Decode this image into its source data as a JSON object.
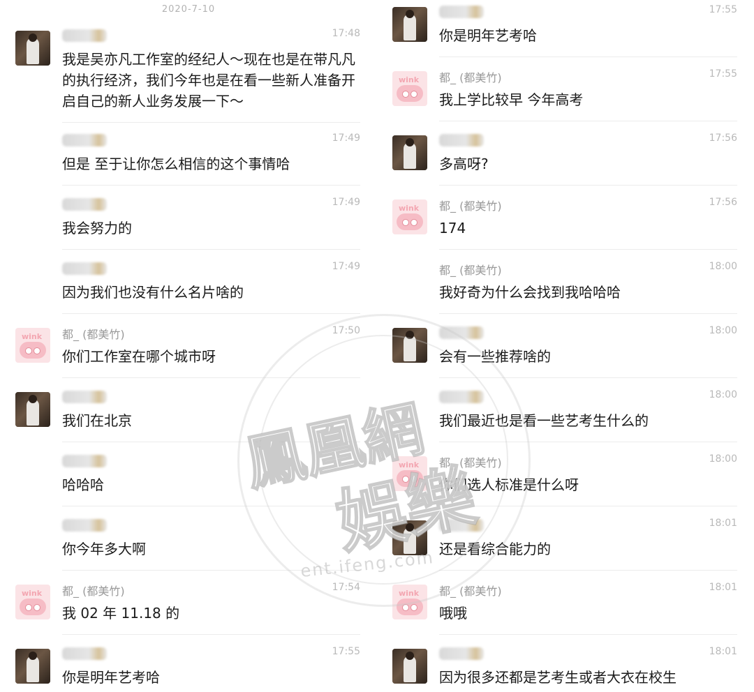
{
  "date_divider": "2020-7-10",
  "contacts": {
    "agent_name": "",
    "user_name": "都_ (都美竹)"
  },
  "left_messages": [
    {
      "sender": "agent",
      "time": "17:48",
      "text": "我是吴亦凡工作室的经纪人～现在也是在带凡凡的执行经济，我们今年也是在看一些新人准备开启自己的新人业务发展一下～"
    },
    {
      "sender": "agent",
      "time": "17:49",
      "text": "但是 至于让你怎么相信的这个事情哈"
    },
    {
      "sender": "agent",
      "time": "17:49",
      "text": "我会努力的"
    },
    {
      "sender": "agent",
      "time": "17:49",
      "text": "因为我们也没有什么名片啥的"
    },
    {
      "sender": "user",
      "time": "17:50",
      "text": "你们工作室在哪个城市呀"
    },
    {
      "sender": "agent",
      "time": "",
      "text": "我们在北京"
    },
    {
      "sender": "agent",
      "time": "",
      "text": "哈哈哈"
    },
    {
      "sender": "agent",
      "time": "",
      "text": "你今年多大啊"
    },
    {
      "sender": "user",
      "time": "17:54",
      "text": "我 02 年 11.18 的"
    },
    {
      "sender": "agent",
      "time": "17:55",
      "text": "你是明年艺考哈"
    }
  ],
  "right_messages": [
    {
      "sender": "agent",
      "time": "17:55",
      "text": "你是明年艺考哈"
    },
    {
      "sender": "user",
      "time": "17:55",
      "text": "我上学比较早 今年高考"
    },
    {
      "sender": "agent",
      "time": "17:56",
      "text": "多高呀?"
    },
    {
      "sender": "user",
      "time": "17:56",
      "text": "174"
    },
    {
      "sender": "user",
      "time": "18:00",
      "text": "我好奇为什么会找到我哈哈哈"
    },
    {
      "sender": "agent",
      "time": "18:00",
      "text": "会有一些推荐啥的"
    },
    {
      "sender": "agent",
      "time": "18:00",
      "text": "我们最近也是看一些艺考生什么的"
    },
    {
      "sender": "user",
      "time": "18:00",
      "text": "你们选人标准是什么呀"
    },
    {
      "sender": "agent",
      "time": "18:01",
      "text": "还是看综合能力的"
    },
    {
      "sender": "user",
      "time": "18:01",
      "text": "哦哦"
    },
    {
      "sender": "agent",
      "time": "18:01",
      "text": "因为很多还都是艺考生或者大衣在校生"
    }
  ],
  "watermark": {
    "line1": "鳳凰網",
    "line2": "娛樂",
    "url": "ent.ifeng.com"
  }
}
